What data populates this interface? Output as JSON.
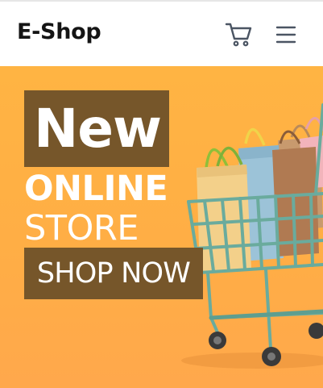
{
  "header": {
    "brand": "E-Shop",
    "icons": [
      "cart-icon",
      "hamburger-menu-icon"
    ]
  },
  "hero": {
    "title": "New",
    "line1": "ONLINE",
    "line2": "STORE",
    "cta_label": "SHOP NOW",
    "image": "shopping-cart-with-bags"
  },
  "colors": {
    "hero_background": "#ffb040",
    "label_background": "#76562a",
    "brand_text": "#141414",
    "icon_color": "#4b5563"
  }
}
